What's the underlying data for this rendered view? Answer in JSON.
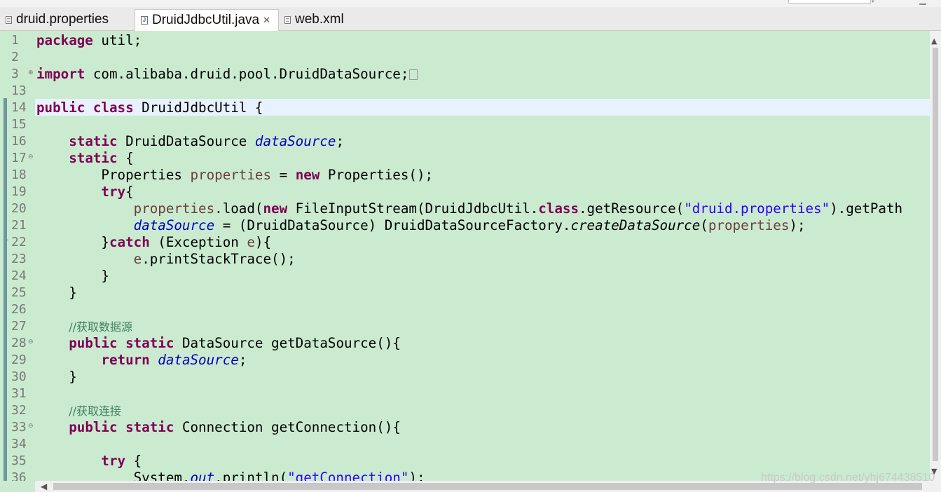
{
  "tabs": [
    {
      "label": "druid.properties",
      "icon": "properties-file-icon"
    },
    {
      "label": "DruidJdbcUtil.java",
      "icon": "java-file-icon",
      "active": true,
      "close": "✕"
    },
    {
      "label": "web.xml",
      "icon": "xml-file-icon"
    }
  ],
  "editor": {
    "line_numbers": [
      "1",
      "2",
      "3",
      "13",
      "14",
      "15",
      "16",
      "17",
      "18",
      "19",
      "20",
      "21",
      "22",
      "23",
      "24",
      "25",
      "26",
      "27",
      "28",
      "29",
      "30",
      "31",
      "32",
      "33",
      "34",
      "35",
      "36"
    ],
    "lines": {
      "l1_kw": "package",
      "l1_rest": " util;",
      "l3_kw": "import",
      "l3_rest": " com.alibaba.druid.pool.DruidDataSource;",
      "l14_kw": "public class",
      "l14_rest": " DruidJdbcUtil {",
      "l16_kw": "static",
      "l16_a": " DruidDataSource ",
      "l16_fld": "dataSource",
      "l16_end": ";",
      "l17_kw": "static",
      "l17_rest": " {",
      "l18_a": "Properties ",
      "l18_var": "properties",
      "l18_b": " = ",
      "l18_kw": "new",
      "l18_c": " Properties();",
      "l19_kw": "try",
      "l19_rest": "{",
      "l20_var": "properties",
      "l20_a": ".load(",
      "l20_kw": "new",
      "l20_b": " FileInputStream(DruidJdbcUtil.",
      "l20_kw2": "class",
      "l20_c": ".getResource(",
      "l20_str": "\"druid.properties\"",
      "l20_d": ").getPath",
      "l21_fld": "dataSource",
      "l21_a": " = (DruidDataSource) DruidDataSourceFactory.",
      "l21_ita": "createDataSource",
      "l21_b": "(",
      "l21_var": "properties",
      "l21_c": ");",
      "l22_a": "}",
      "l22_kw": "catch",
      "l22_b": " (Exception ",
      "l22_var": "e",
      "l22_c": "){",
      "l23_var": "e",
      "l23_a": ".printStackTrace();",
      "l24": "}",
      "l25": "}",
      "l27_cmt": "//获取数据源",
      "l28_kw": "public static",
      "l28_rest": " DataSource getDataSource(){",
      "l29_kw": "return",
      "l29_a": " ",
      "l29_fld": "dataSource",
      "l29_b": ";",
      "l30": "}",
      "l32_cmt": "//获取连接",
      "l33_kw": "public static",
      "l33_rest": " Connection getConnection(){",
      "l35_kw": "try",
      "l35_rest": " {",
      "l36_a": "System.",
      "l36_fld": "out",
      "l36_b": ".println(",
      "l36_str": "\"getConnection\"",
      "l36_c": ");"
    }
  },
  "watermark": "https://blog.csdn.net/yhj674438510",
  "colors": {
    "editor_bg": "#cbebd0",
    "keyword": "#7f0055",
    "field": "#0000c0",
    "string": "#2a00ff",
    "comment": "#3f7f5f",
    "current_line": "#e8f2fe"
  }
}
